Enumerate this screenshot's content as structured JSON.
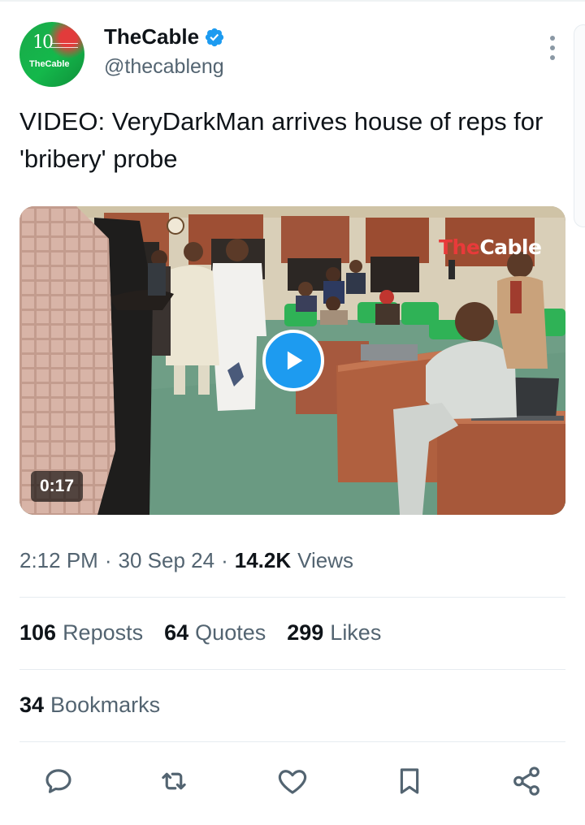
{
  "account": {
    "display_name": "TheCable",
    "handle": "@thecableng",
    "verified": true,
    "avatar": {
      "badge_text": "10",
      "logo_text": "TheCable"
    },
    "more_icon": "more-vertical-icon"
  },
  "tweet": {
    "text": "VIDEO: VeryDarkMan arrives house of reps for 'bribery' probe"
  },
  "media": {
    "type": "video",
    "duration": "0:17",
    "watermark_part1": "The",
    "watermark_part2": "Cable",
    "play_icon": "play-icon"
  },
  "meta": {
    "time": "2:12 PM",
    "separator": "·",
    "date": "30 Sep 24",
    "views_count": "14.2K",
    "views_label": "Views"
  },
  "stats": {
    "reposts_count": "106",
    "reposts_label": "Reposts",
    "quotes_count": "64",
    "quotes_label": "Quotes",
    "likes_count": "299",
    "likes_label": "Likes",
    "bookmarks_count": "34",
    "bookmarks_label": "Bookmarks"
  },
  "actions": [
    "reply-icon",
    "repost-icon",
    "like-icon",
    "bookmark-icon",
    "share-icon"
  ],
  "colors": {
    "accent": "#1d9bf0",
    "text_primary": "#0f1419",
    "text_secondary": "#536471",
    "divider": "#e6ecf0",
    "icon": "#536471",
    "avatar_green": "#14b84b"
  }
}
